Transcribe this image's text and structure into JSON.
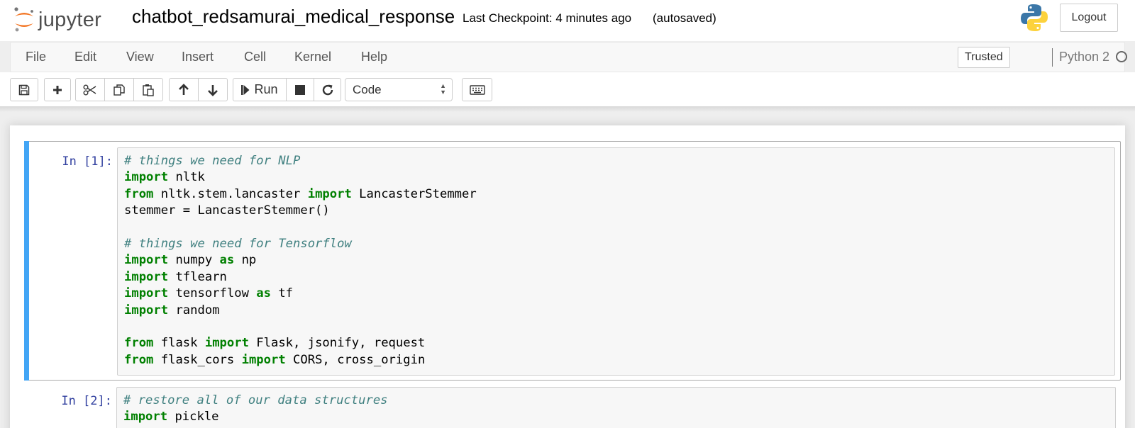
{
  "header": {
    "logo_text": "jupyter",
    "notebook_name": "chatbot_redsamurai_medical_response",
    "checkpoint": "Last Checkpoint: 4 minutes ago",
    "autosave_status": "(autosaved)",
    "logout_label": "Logout"
  },
  "menubar": {
    "items": [
      "File",
      "Edit",
      "View",
      "Insert",
      "Cell",
      "Kernel",
      "Help"
    ],
    "trusted_label": "Trusted",
    "kernel_name": "Python 2"
  },
  "toolbar": {
    "run_label": "Run",
    "cell_type": "Code",
    "icons": [
      "save-icon",
      "plus-icon",
      "scissors-icon",
      "copy-icon",
      "paste-icon",
      "arrow-up-icon",
      "arrow-down-icon",
      "step-forward-icon",
      "stop-icon",
      "refresh-icon",
      "keyboard-icon"
    ]
  },
  "cells": [
    {
      "prompt": "In [1]:",
      "lines": [
        [
          {
            "t": "# things we need for NLP",
            "c": "cm"
          }
        ],
        [
          {
            "t": "import",
            "c": "kw"
          },
          {
            "t": " nltk",
            "c": ""
          }
        ],
        [
          {
            "t": "from",
            "c": "kw"
          },
          {
            "t": " nltk.stem.lancaster ",
            "c": ""
          },
          {
            "t": "import",
            "c": "kw"
          },
          {
            "t": " LancasterStemmer",
            "c": ""
          }
        ],
        [
          {
            "t": "stemmer = LancasterStemmer()",
            "c": ""
          }
        ],
        [],
        [
          {
            "t": "# things we need for Tensorflow",
            "c": "cm"
          }
        ],
        [
          {
            "t": "import",
            "c": "kw"
          },
          {
            "t": " numpy ",
            "c": ""
          },
          {
            "t": "as",
            "c": "kw"
          },
          {
            "t": " np",
            "c": ""
          }
        ],
        [
          {
            "t": "import",
            "c": "kw"
          },
          {
            "t": " tflearn",
            "c": ""
          }
        ],
        [
          {
            "t": "import",
            "c": "kw"
          },
          {
            "t": " tensorflow ",
            "c": ""
          },
          {
            "t": "as",
            "c": "kw"
          },
          {
            "t": " tf",
            "c": ""
          }
        ],
        [
          {
            "t": "import",
            "c": "kw"
          },
          {
            "t": " random",
            "c": ""
          }
        ],
        [],
        [
          {
            "t": "from",
            "c": "kw"
          },
          {
            "t": " flask ",
            "c": ""
          },
          {
            "t": "import",
            "c": "kw"
          },
          {
            "t": " Flask, jsonify, request",
            "c": ""
          }
        ],
        [
          {
            "t": "from",
            "c": "kw"
          },
          {
            "t": " flask_cors ",
            "c": ""
          },
          {
            "t": "import",
            "c": "kw"
          },
          {
            "t": " CORS, cross_origin",
            "c": ""
          }
        ]
      ]
    },
    {
      "prompt": "In [2]:",
      "lines": [
        [
          {
            "t": "# restore all of our data structures",
            "c": "cm"
          }
        ],
        [
          {
            "t": "import",
            "c": "kw"
          },
          {
            "t": " pickle",
            "c": ""
          }
        ]
      ]
    }
  ],
  "colors": {
    "selected_bar": "#42a5f5",
    "prompt": "#303f9f",
    "keyword": "#008000",
    "comment": "#408080",
    "logo_orange": "#f37726"
  }
}
